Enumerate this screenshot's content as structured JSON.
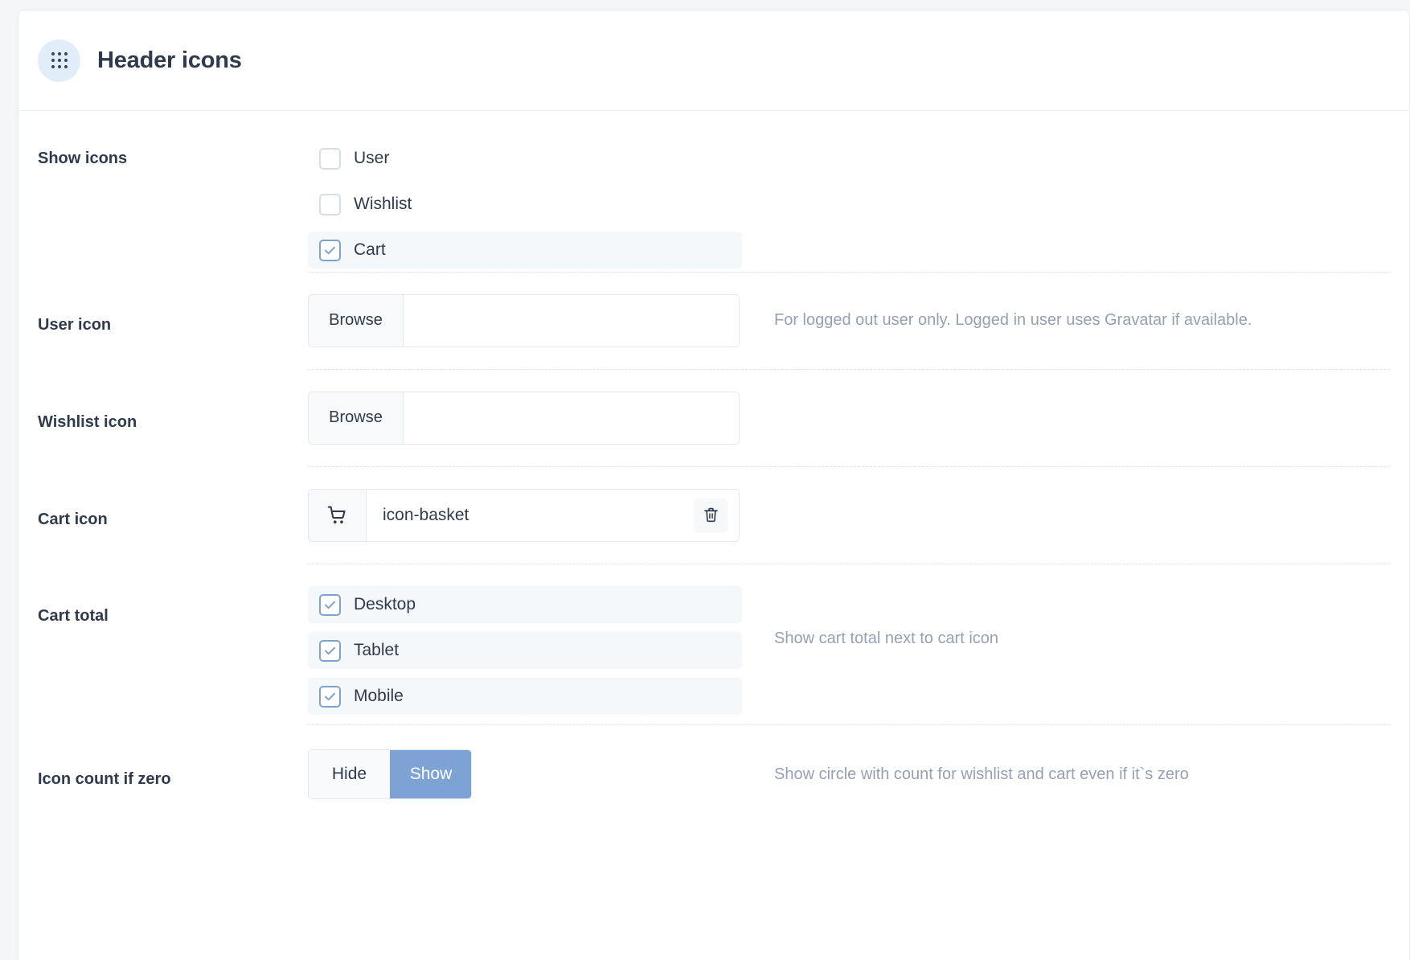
{
  "panel": {
    "title": "Header icons",
    "drag_handle_icon": "drag-dots-icon"
  },
  "rows": {
    "show_icons": {
      "label": "Show icons",
      "options": [
        {
          "label": "User",
          "checked": false
        },
        {
          "label": "Wishlist",
          "checked": false
        },
        {
          "label": "Cart",
          "checked": true
        }
      ]
    },
    "user_icon": {
      "label": "User icon",
      "browse_label": "Browse",
      "value": "",
      "help": "For logged out user only. Logged in user uses Gravatar if available."
    },
    "wishlist_icon": {
      "label": "Wishlist icon",
      "browse_label": "Browse",
      "value": "",
      "help": ""
    },
    "cart_icon": {
      "label": "Cart icon",
      "prefix_icon": "shopping-cart-icon",
      "value": "icon-basket",
      "clear_icon": "trash-icon",
      "help": ""
    },
    "cart_total": {
      "label": "Cart total",
      "options": [
        {
          "label": "Desktop",
          "checked": true
        },
        {
          "label": "Tablet",
          "checked": true
        },
        {
          "label": "Mobile",
          "checked": true
        }
      ],
      "help": "Show cart total next to cart icon"
    },
    "icon_count_if_zero": {
      "label": "Icon count if zero",
      "options": [
        {
          "label": "Hide",
          "active": false
        },
        {
          "label": "Show",
          "active": true
        }
      ],
      "help": "Show circle with count for wishlist and cart even if it`s zero"
    }
  },
  "colors": {
    "accent": "#7da3d4",
    "checkbox_checked_border": "#7fa2cc",
    "row_highlight": "#f4f8fb",
    "text": "#2f3b4d",
    "help_text": "#96a0b3",
    "badge_bg": "#e2edfa"
  }
}
